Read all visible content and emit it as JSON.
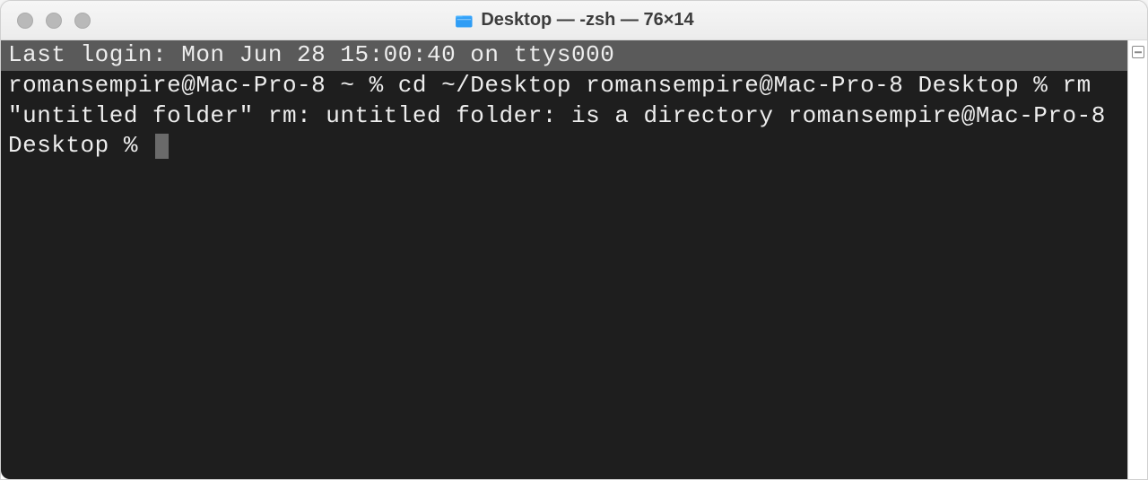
{
  "titlebar": {
    "window_title": "Desktop — -zsh — 76×14"
  },
  "terminal": {
    "last_login": "Last login: Mon Jun 28 15:00:40 on ttys000",
    "line1_prompt": "romansempire@Mac-Pro-8 ~ % ",
    "line1_cmd": "cd ~/Desktop",
    "line2_prompt": "romansempire@Mac-Pro-8 Desktop % ",
    "line2_cmd": "rm \"untitled folder\"",
    "line3": "rm: untitled folder: is a directory",
    "line4_prompt": "romansempire@Mac-Pro-8 Desktop % "
  }
}
